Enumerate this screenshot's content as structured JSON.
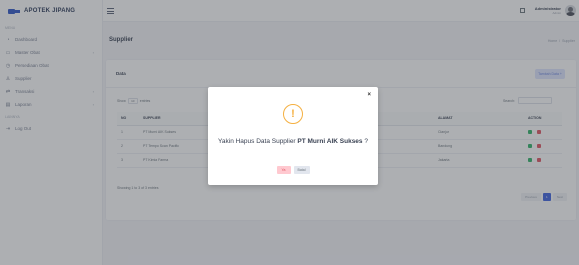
{
  "brand": {
    "title": "APOTEK JIPANG",
    "icon": "truck-logo-icon"
  },
  "sidebar": {
    "section_menu": "MENU",
    "section_other": "LAINNYA",
    "items": [
      {
        "label": "Dashboard",
        "icon": "gauge-icon"
      },
      {
        "label": "Master Obat",
        "icon": "box-icon",
        "has_children": true
      },
      {
        "label": "Persediaan Obat",
        "icon": "clock-icon"
      },
      {
        "label": "Supplier",
        "icon": "user-icon"
      },
      {
        "label": "Transaksi",
        "icon": "swap-icon",
        "has_children": true
      },
      {
        "label": "Laporan",
        "icon": "report-icon",
        "has_children": true
      }
    ],
    "logout": {
      "label": "Log Out",
      "icon": "logout-icon"
    }
  },
  "topbar": {
    "user_name": "Administrator",
    "user_role": "Admin"
  },
  "page": {
    "title": "Supplier",
    "breadcrumb": [
      "Home",
      "Supplier"
    ]
  },
  "card": {
    "title": "Data",
    "add_button": "Tambah Data +"
  },
  "table": {
    "show_label": "Show",
    "entries_value": "10",
    "entries_label": "entries",
    "search_label": "Search:",
    "columns": [
      "NO",
      "SUPPLIER",
      "ALAMAT",
      "ACTION"
    ],
    "rows": [
      {
        "no": "1",
        "supplier": "PT Murni AIK Sukses",
        "alamat": "Cianjur"
      },
      {
        "no": "2",
        "supplier": "PT Tempo Scan Pacific",
        "alamat": "Bandung"
      },
      {
        "no": "3",
        "supplier": "PT Kimia Farma",
        "alamat": "Jakarta"
      }
    ],
    "showing": "Showing 1 to 3 of 3 entries",
    "pager": {
      "previous": "Previous",
      "current": "1",
      "next": "Next"
    }
  },
  "modal": {
    "question_prefix": "Yakin Hapus Data Supplier ",
    "question_target": "PT Murni AIK Sukses",
    "question_suffix": " ?",
    "yes_label": "Ya",
    "no_label": "Batal",
    "close_label": "×",
    "warn_symbol": "!"
  },
  "colors": {
    "primary": "#3e63e0",
    "warning": "#f5b041",
    "danger": "#e05563",
    "success": "#31b46a"
  }
}
